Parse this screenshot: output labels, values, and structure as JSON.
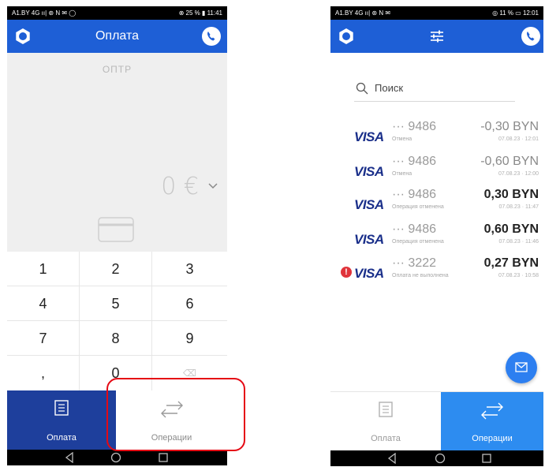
{
  "left_screen": {
    "status_bar": {
      "left": "A1.BY 4G ıı|  ⊛ Ν ✉ ◯",
      "right": "⊗ 25 % ▮ 11:41"
    },
    "header": {
      "title": "Оплата",
      "settings_icon": "gear-icon",
      "phone_icon": "phone-icon"
    },
    "display": {
      "merchant": "ОПТР",
      "amount": "0 €",
      "currency_dropdown_icon": "chevron-down-icon",
      "card_icon": "card-icon"
    },
    "keypad": [
      "1",
      "2",
      "3",
      "4",
      "5",
      "6",
      "7",
      "8",
      "9",
      ",",
      "0",
      "⌫"
    ],
    "tabs": [
      {
        "label": "Оплата",
        "icon": "receipt-icon",
        "active": true
      },
      {
        "label": "Операции",
        "icon": "transfer-arrows-icon",
        "active": false
      }
    ],
    "colors": {
      "accent": "#1e5fd6",
      "tab_active_bg": "#1e3f9c",
      "highlight": "#e50914"
    }
  },
  "right_screen": {
    "status_bar": {
      "left": "A1.BY 4G ıı|  ⊛ Ν ✉",
      "right": "◎ 11 % ▭ 12:01"
    },
    "header": {
      "settings_icon": "gear-icon",
      "filter_icon": "filter-sliders-icon",
      "phone_icon": "phone-icon"
    },
    "search": {
      "placeholder": "Поиск"
    },
    "transactions": [
      {
        "brand": "VISA",
        "card": "··· 9486",
        "status": "Отмена",
        "amount": "-0,30 BYN",
        "date": "07.08.23 · 12:01",
        "alert": ""
      },
      {
        "brand": "VISA",
        "card": "··· 9486",
        "status": "Отмена",
        "amount": "-0,60 BYN",
        "date": "07.08.23 · 12:00",
        "alert": ""
      },
      {
        "brand": "VISA",
        "card": "··· 9486",
        "status": "Операция отменена",
        "amount": "0,30 BYN",
        "date": "07.08.23 · 11:47",
        "alert": ""
      },
      {
        "brand": "VISA",
        "card": "··· 9486",
        "status": "Операция отменена",
        "amount": "0,60 BYN",
        "date": "07.08.23 · 11:46",
        "alert": ""
      },
      {
        "brand": "VISA",
        "card": "··· 3222",
        "status": "Оплата не выполнена",
        "amount": "0,27 BYN",
        "date": "07.08.23 · 10:58",
        "alert": "!"
      }
    ],
    "fab_icon": "mail-icon",
    "tabs": [
      {
        "label": "Оплата",
        "icon": "receipt-icon",
        "active": false
      },
      {
        "label": "Операции",
        "icon": "transfer-arrows-icon",
        "active": true
      }
    ],
    "colors": {
      "accent": "#1e5fd6",
      "tab_active_bg": "#2d8cf0",
      "error": "#e0343b",
      "visa": "#1a2f8a"
    }
  }
}
